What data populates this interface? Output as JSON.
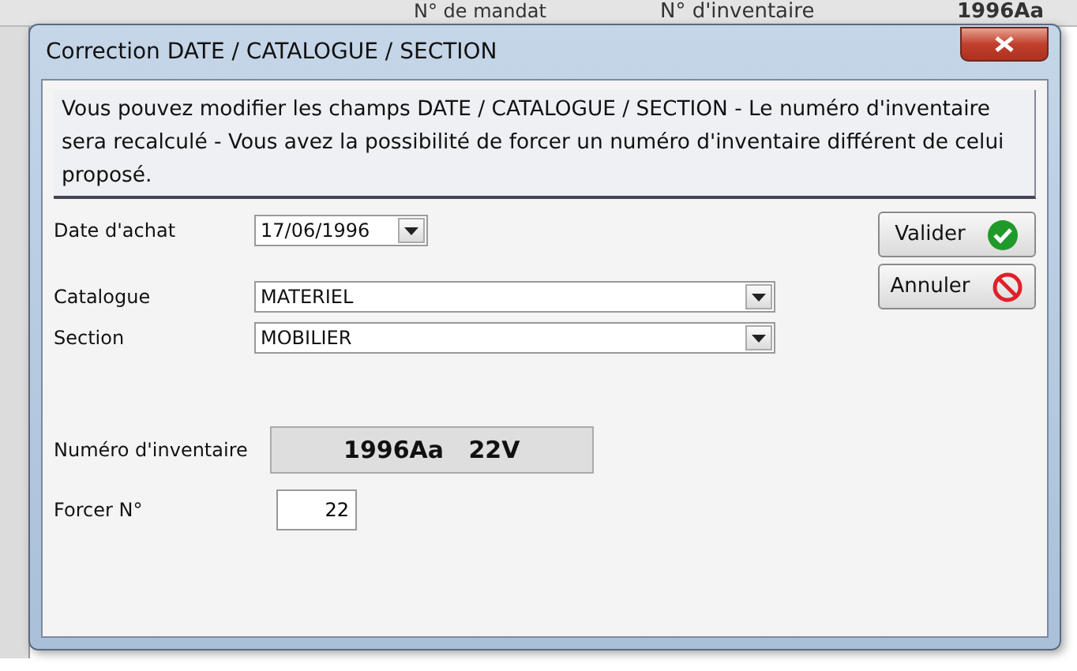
{
  "background": {
    "texts": [
      "N° de mandat",
      "N° d'inventaire",
      "1996Aa"
    ]
  },
  "window": {
    "title": "Correction DATE / CATALOGUE / SECTION"
  },
  "info": "Vous pouvez modifier les champs DATE / CATALOGUE / SECTION - Le numéro d'inventaire sera recalculé - Vous avez la possibilité de forcer un numéro d'inventaire différent de celui proposé.",
  "date": {
    "label": "Date d'achat",
    "value": "17/06/1996"
  },
  "catalogue": {
    "label": "Catalogue",
    "value": "MATERIEL"
  },
  "section": {
    "label": "Section",
    "value": "MOBILIER"
  },
  "inventory": {
    "label": "Numéro d'inventaire",
    "value": "1996Aa   22V"
  },
  "force": {
    "label": "Forcer N°",
    "value": "22"
  },
  "buttons": [
    {
      "kind": "ok",
      "label": "Valider"
    },
    {
      "kind": "cancel",
      "label": "Annuler"
    }
  ]
}
